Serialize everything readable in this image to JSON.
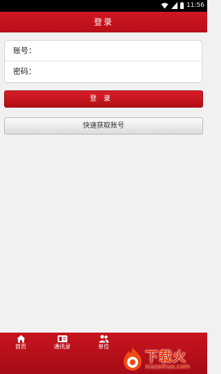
{
  "status_bar": {
    "time": "11:56"
  },
  "header": {
    "title": "登录"
  },
  "form": {
    "account_label": "账号：",
    "password_label": "密码："
  },
  "buttons": {
    "login_label": "登录",
    "quick_account_label": "快速获取账号"
  },
  "bottom_nav": {
    "items": [
      {
        "label": "首页",
        "icon": "home-icon"
      },
      {
        "label": "通讯录",
        "icon": "contacts-icon"
      },
      {
        "label": "单位",
        "icon": "people-icon"
      }
    ]
  },
  "watermark": {
    "brand": "下载火",
    "url": "xiazaihuo.com"
  },
  "colors": {
    "brand_red": "#c8141e",
    "watermark_orange": "#e8380d"
  }
}
